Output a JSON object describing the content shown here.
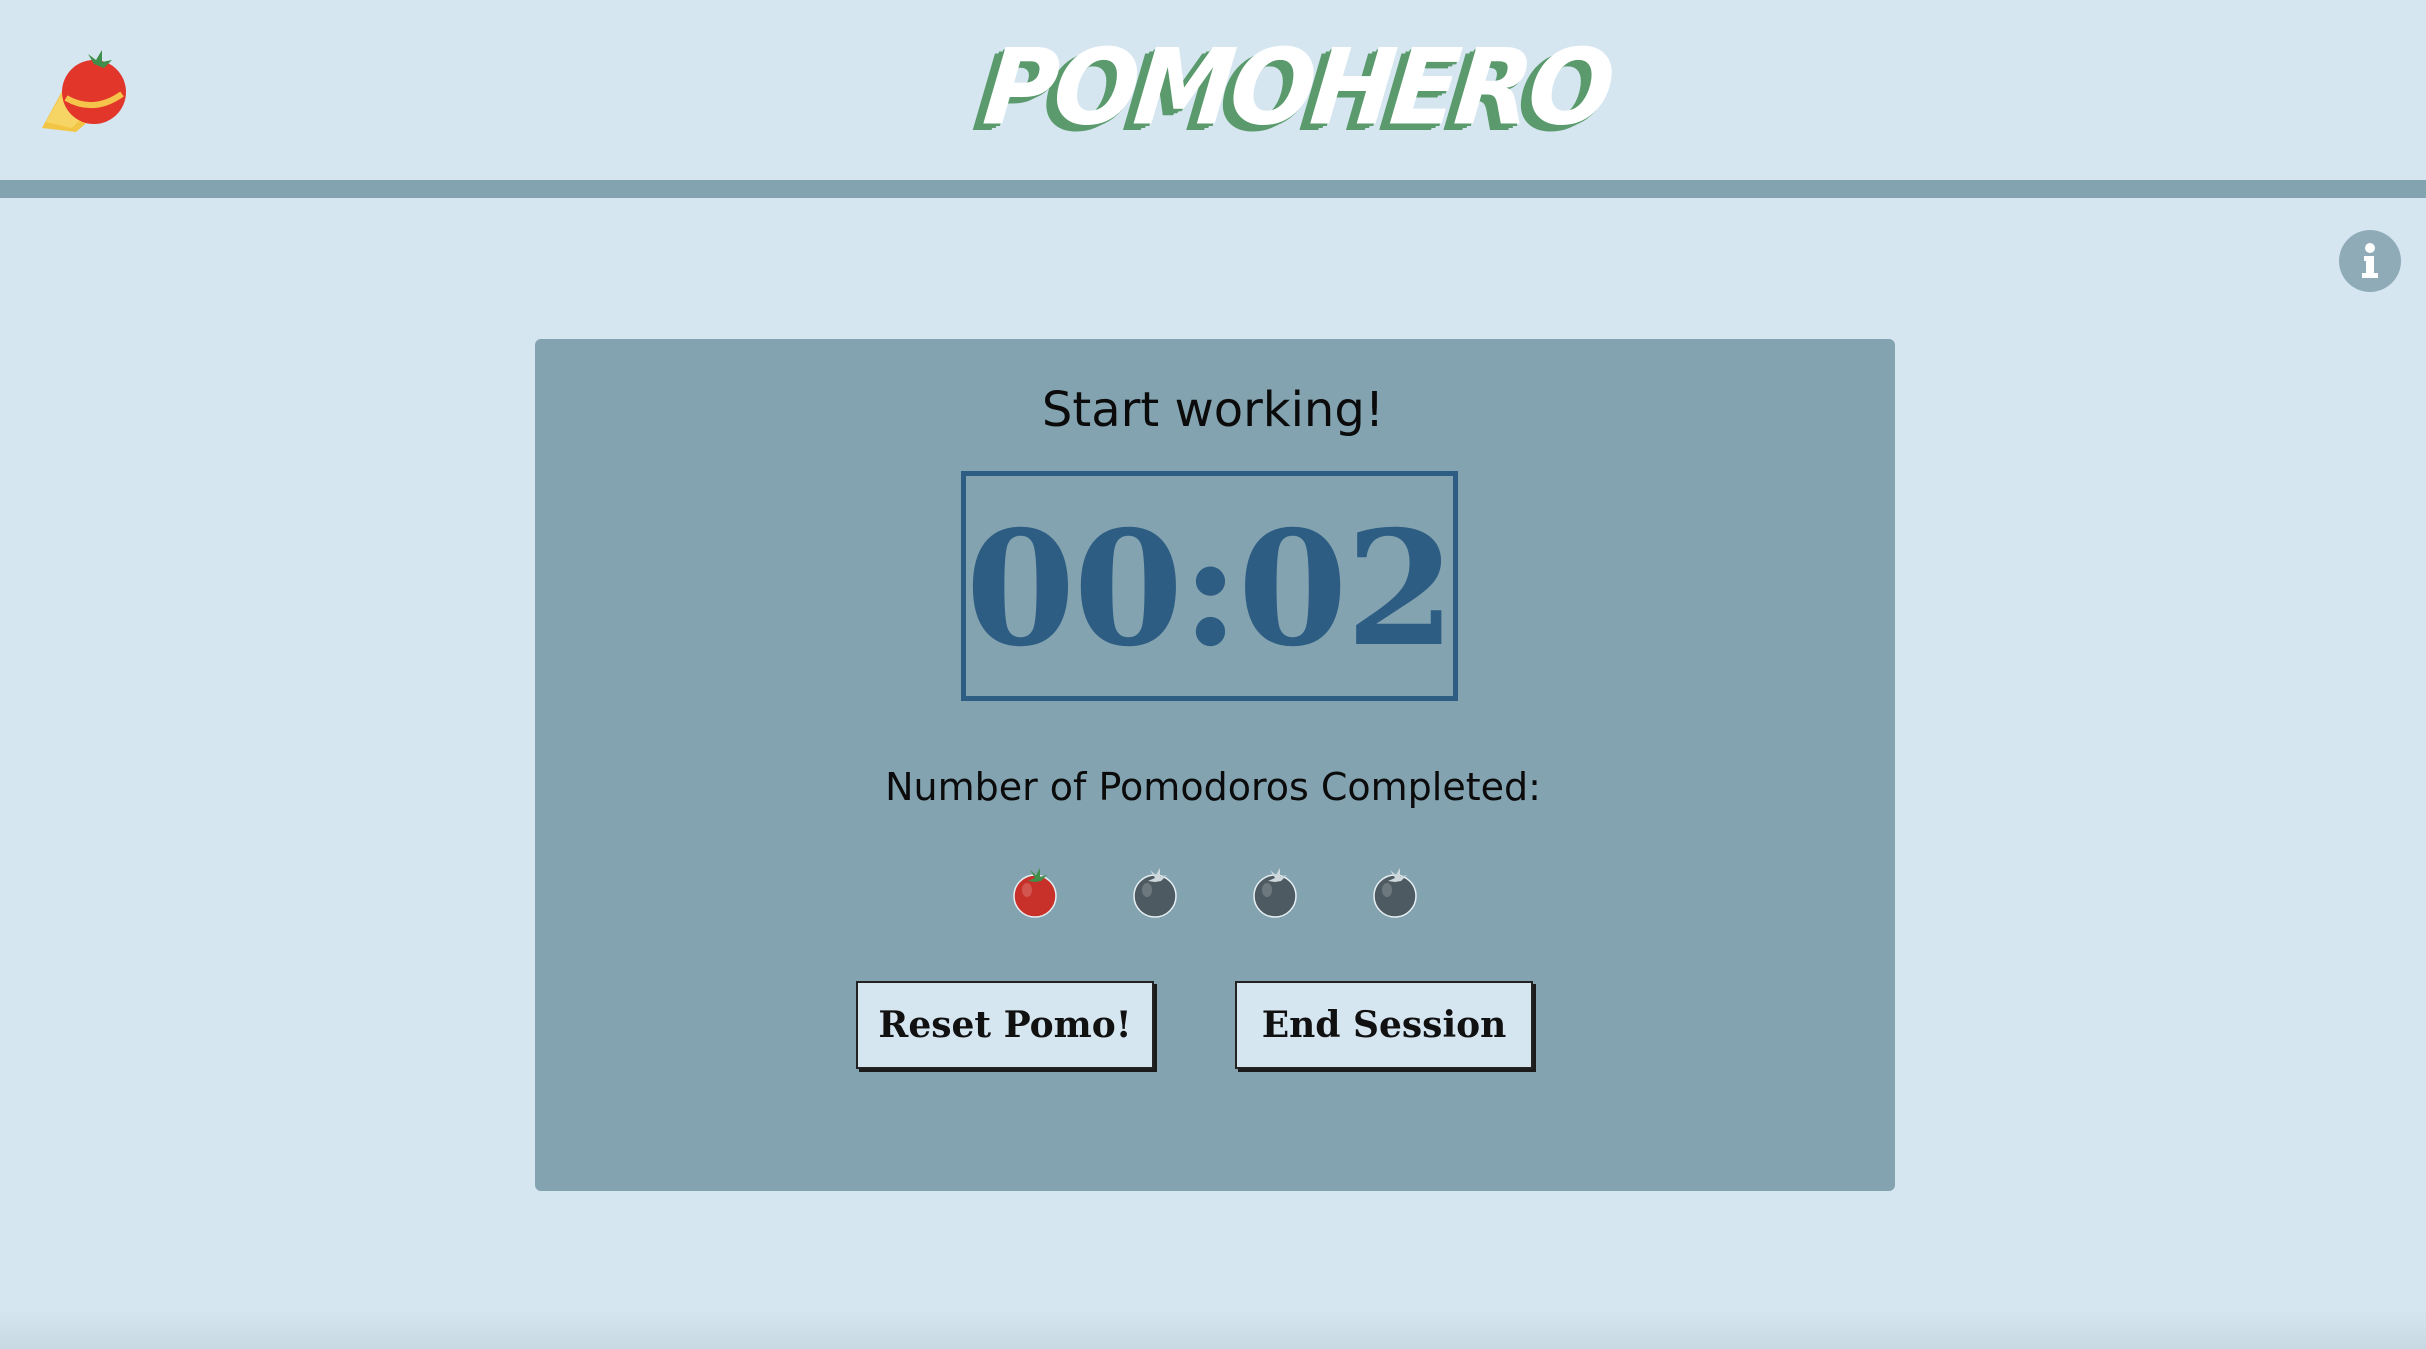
{
  "header": {
    "brand": "POMOHERO",
    "logo_icon": "tomato-hero-icon",
    "info_icon": "info-icon"
  },
  "panel": {
    "title": "Start working!",
    "timer": "00:02",
    "count_label": "Number of Pomodoros Completed:",
    "pomodoros_completed": 1,
    "pomodoros_total": 4
  },
  "buttons": {
    "reset_label": "Reset Pomo!",
    "end_label": "End Session"
  },
  "colors": {
    "background": "#d5e6f1",
    "panel": "#83a3b1",
    "timer": "#2d5d82",
    "brand_green": "#5a9a6c",
    "tomato_done": "#c8302a",
    "tomato_pending": "#4d5a62"
  }
}
